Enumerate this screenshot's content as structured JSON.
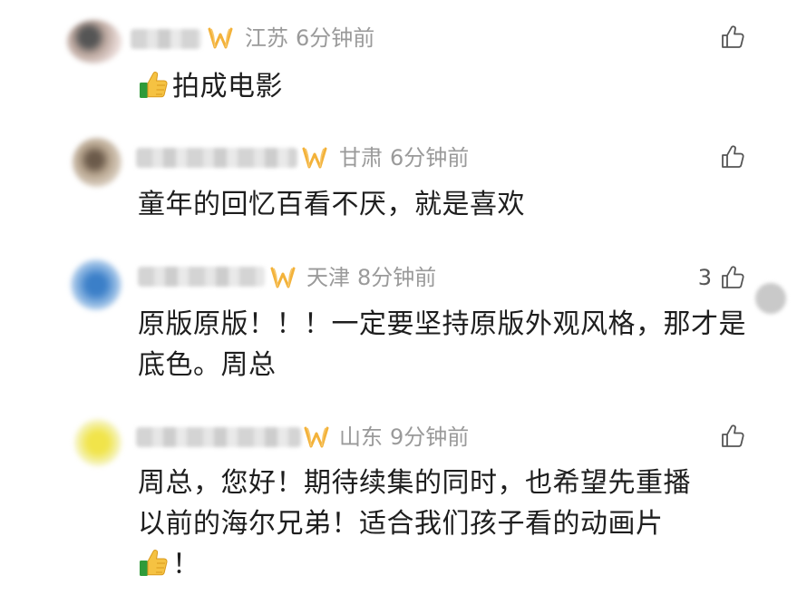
{
  "comments": [
    {
      "region": "江苏",
      "time": "6分钟前",
      "text": "拍成电影",
      "likes": "",
      "emoji_before": true,
      "emoji_after": false
    },
    {
      "region": "甘肃",
      "time": "6分钟前",
      "text": "童年的回忆百看不厌，就是喜欢",
      "likes": "",
      "emoji_before": false,
      "emoji_after": false
    },
    {
      "region": "天津",
      "time": "8分钟前",
      "text": "原版原版！！！一定要坚持原版外观风格，那才是底色。周总",
      "likes": "3",
      "emoji_before": false,
      "emoji_after": false
    },
    {
      "region": "山东",
      "time": "9分钟前",
      "text_line1": "周总，您好！期待续集的同时，也希望先重播",
      "text_line2": "以前的海尔兄弟！适合我们孩子看的动画片",
      "text_line3": "！",
      "likes": "",
      "emoji_after": true
    }
  ],
  "colors": {
    "meta": "#9a9a9a",
    "text": "#1e1e1e",
    "vip": "#f3b23a",
    "like": "#555555"
  },
  "icons": {
    "like": "thumbs-up-outline-icon",
    "vip": "vip-badge-icon",
    "emoji": "thumbs-up-emoji-icon"
  }
}
